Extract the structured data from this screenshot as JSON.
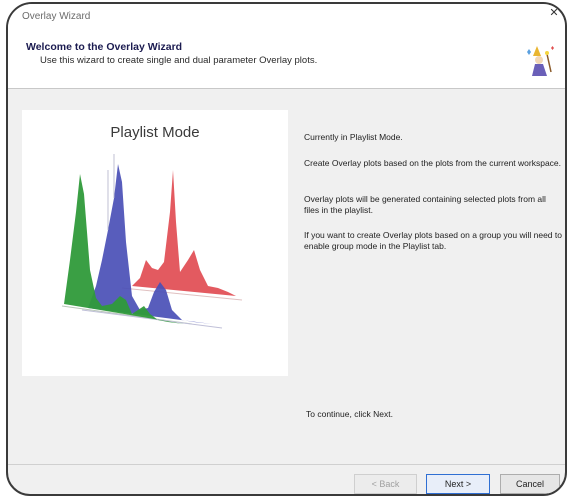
{
  "window": {
    "title": "Overlay Wizard"
  },
  "header": {
    "title": "Welcome to the Overlay Wizard",
    "subtitle": "Use this wizard to create single and dual parameter Overlay plots."
  },
  "panel": {
    "title": "Playlist Mode"
  },
  "info": {
    "line1": "Currently in Playlist Mode.",
    "line2": "Create Overlay plots based on the plots from the current workspace.",
    "line3": "Overlay plots will be generated containing selected plots from all files in the playlist.",
    "line4": "If you want to create Overlay plots based on a group you will need to enable group mode in the Playlist tab."
  },
  "footer": {
    "continue_text": "To continue, click Next.",
    "back_label": "< Back",
    "next_label": "Next >",
    "cancel_label": "Cancel"
  },
  "colors": {
    "green": "#2f9a3a",
    "blue": "#4a4fb6",
    "red": "#e0484f",
    "title_text": "#1b1b50"
  },
  "icons": {
    "close": "close-icon",
    "wizard": "wizard-icon"
  }
}
